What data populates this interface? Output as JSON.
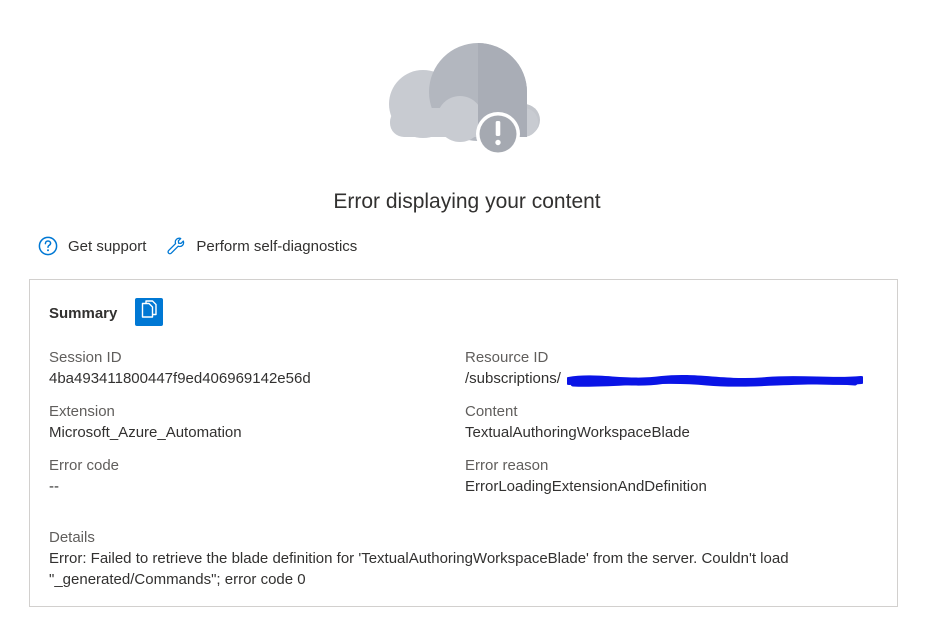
{
  "header": {
    "title": "Error displaying your content"
  },
  "actions": {
    "support_label": "Get support",
    "diagnostics_label": "Perform self-diagnostics"
  },
  "summary": {
    "label": "Summary",
    "fields": {
      "session_id": {
        "label": "Session ID",
        "value": "4ba493411800447f9ed406969142e56d"
      },
      "resource_id": {
        "label": "Resource ID",
        "value": "/subscriptions/"
      },
      "extension": {
        "label": "Extension",
        "value": "Microsoft_Azure_Automation"
      },
      "content": {
        "label": "Content",
        "value": "TextualAuthoringWorkspaceBlade"
      },
      "error_code": {
        "label": "Error code",
        "value": "--"
      },
      "error_reason": {
        "label": "Error reason",
        "value": "ErrorLoadingExtensionAndDefinition"
      },
      "details": {
        "label": "Details",
        "value": "Error: Failed to retrieve the blade definition for 'TextualAuthoringWorkspaceBlade' from the server. Couldn't load \"_generated/Commands\"; error code 0"
      }
    }
  },
  "icons": {
    "hero": "cloud-error-icon",
    "support": "question-circle-icon",
    "diagnostics": "wrench-icon",
    "copy": "copy-icon"
  },
  "colors": {
    "accent": "#0078d4",
    "text": "#323130",
    "label": "#605e5c",
    "border": "#d2d0ce",
    "redaction": "#0a14e6"
  }
}
